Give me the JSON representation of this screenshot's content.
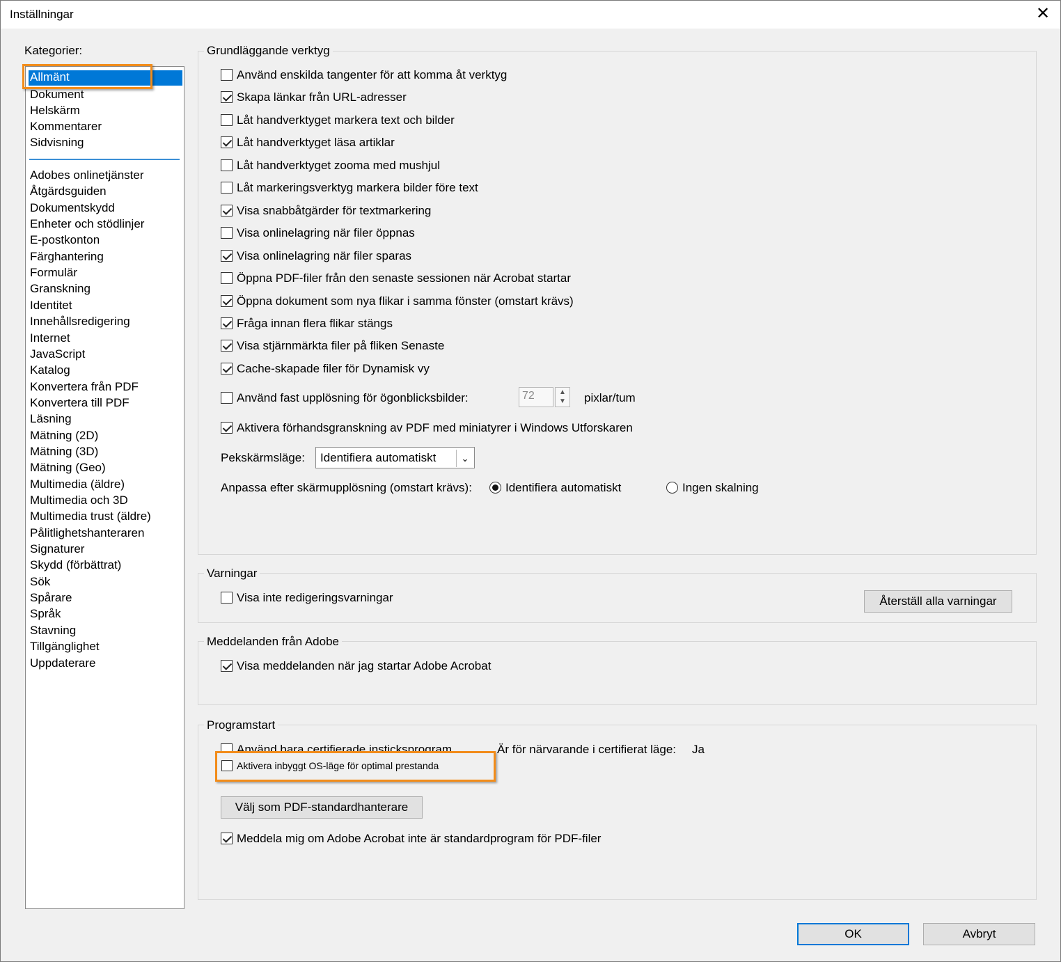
{
  "window": {
    "title": "Inställningar",
    "close_glyph": "✕"
  },
  "categories": {
    "label": "Kategorier:",
    "top_items": [
      "Allmänt",
      "Dokument",
      "Helskärm",
      "Kommentarer",
      "Sidvisning"
    ],
    "selected": "Allmänt",
    "items": [
      "Adobes onlinetjänster",
      "Åtgärdsguiden",
      "Dokumentskydd",
      "Enheter och stödlinjer",
      "E-postkonton",
      "Färghantering",
      "Formulär",
      "Granskning",
      "Identitet",
      "Innehållsredigering",
      "Internet",
      "JavaScript",
      "Katalog",
      "Konvertera från PDF",
      "Konvertera till PDF",
      "Läsning",
      "Mätning (2D)",
      "Mätning (3D)",
      "Mätning (Geo)",
      "Multimedia (äldre)",
      "Multimedia och 3D",
      "Multimedia trust (äldre)",
      "Pålitlighetshanteraren",
      "Signaturer",
      "Skydd (förbättrat)",
      "Sök",
      "Spårare",
      "Språk",
      "Stavning",
      "Tillgänglighet",
      "Uppdaterare"
    ]
  },
  "basic_tools": {
    "title": "Grundläggande verktyg",
    "options": [
      {
        "label": "Använd enskilda tangenter för att komma åt verktyg",
        "checked": false
      },
      {
        "label": "Skapa länkar från URL-adresser",
        "checked": true
      },
      {
        "label": "Låt handverktyget markera text och bilder",
        "checked": false
      },
      {
        "label": "Låt handverktyget läsa artiklar",
        "checked": true
      },
      {
        "label": "Låt handverktyget zooma med mushjul",
        "checked": false
      },
      {
        "label": "Låt markeringsverktyg markera bilder före text",
        "checked": false
      },
      {
        "label": "Visa snabbåtgärder för textmarkering",
        "checked": true
      },
      {
        "label": "Visa onlinelagring när filer öppnas",
        "checked": false
      },
      {
        "label": "Visa onlinelagring när filer sparas",
        "checked": true
      },
      {
        "label": "Öppna PDF-filer från den senaste sessionen när Acrobat startar",
        "checked": false
      },
      {
        "label": "Öppna dokument som nya flikar i samma fönster (omstart krävs)",
        "checked": true
      },
      {
        "label": "Fråga innan flera flikar stängs",
        "checked": true
      },
      {
        "label": "Visa stjärnmärkta filer på fliken Senaste",
        "checked": true
      },
      {
        "label": "Cache-skapade filer för Dynamisk vy",
        "checked": true
      }
    ],
    "snapshot": {
      "label": "Använd fast upplösning för ögonblicksbilder:",
      "checked": false,
      "value": "72",
      "unit": "pixlar/tum"
    },
    "preview": {
      "label": "Aktivera förhandsgranskning av PDF med miniatyrer i Windows Utforskaren",
      "checked": true
    },
    "touch_mode": {
      "label": "Pekskärmsläge:",
      "value": "Identifiera automatiskt"
    },
    "scaling": {
      "label": "Anpassa efter skärmupplösning (omstart krävs):",
      "option_auto": "Identifiera automatiskt",
      "option_none": "Ingen skalning",
      "selected": "auto"
    }
  },
  "warnings": {
    "title": "Varningar",
    "option": {
      "label": "Visa inte redigeringsvarningar",
      "checked": false
    },
    "reset_button": "Återställ alla varningar"
  },
  "messages": {
    "title": "Meddelanden från Adobe",
    "option": {
      "label": "Visa meddelanden när jag startar Adobe Acrobat",
      "checked": true
    }
  },
  "startup": {
    "title": "Programstart",
    "certified": {
      "label": "Använd bara certifierade insticksprogram",
      "checked": false
    },
    "certified_mode_label": "Är för närvarande i certifierat läge:",
    "certified_mode_value": "Ja",
    "native_os": {
      "label": "Aktivera inbyggt OS-läge för optimal prestanda",
      "checked": false
    },
    "default_handler_button": "Välj som PDF-standardhanterare",
    "notify": {
      "label": "Meddela mig om Adobe Acrobat inte är standardprogram för PDF-filer",
      "checked": true
    }
  },
  "footer": {
    "ok": "OK",
    "cancel": "Avbryt"
  },
  "colors": {
    "highlight": "#f28c1a",
    "selection": "#0078d7"
  }
}
